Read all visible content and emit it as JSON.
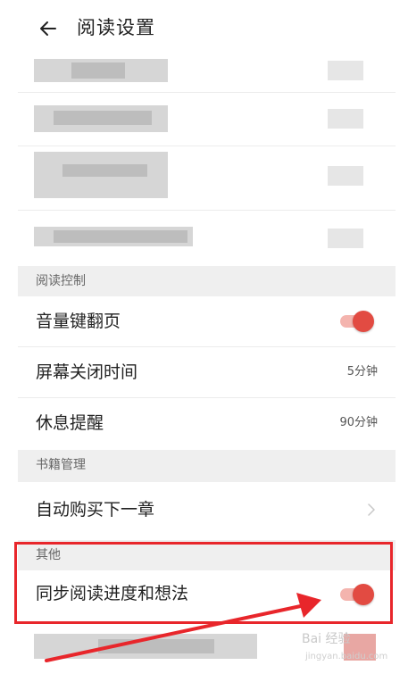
{
  "header": {
    "title": "阅读设置",
    "back_icon": "back-arrow-icon"
  },
  "sections": {
    "reading_control": "阅读控制",
    "book_management": "书籍管理",
    "other": "其他"
  },
  "rows": {
    "volume_page": {
      "label": "音量键翻页",
      "toggle_on": true
    },
    "screen_off": {
      "label": "屏幕关闭时间",
      "value": "5分钟"
    },
    "rest_reminder": {
      "label": "休息提醒",
      "value": "90分钟"
    },
    "auto_buy": {
      "label": "自动购买下一章"
    },
    "sync_progress": {
      "label": "同步阅读进度和想法",
      "toggle_on": true
    }
  },
  "watermark": {
    "text": "Bai 经验",
    "sub": "jingyan.baidu.com"
  },
  "colors": {
    "accent": "#e24b42",
    "track": "#f4b4ae",
    "highlight": "#e8262b",
    "section_bg": "#efefef"
  }
}
